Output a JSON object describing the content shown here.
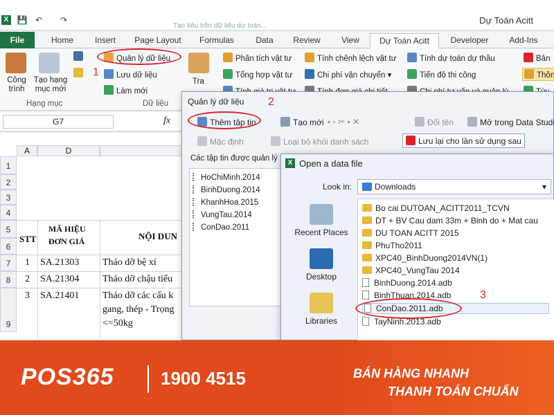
{
  "window": {
    "title": "Dự Toán Acitt",
    "background_title": "Tạo tiêu trên dữ liệu dự toán..."
  },
  "ribbon_tabs": [
    "File",
    "Home",
    "Insert",
    "Page Layout",
    "Formulas",
    "Data",
    "Review",
    "View",
    "Dự Toán Acitt",
    "Developer",
    "Add-Ins"
  ],
  "ribbon": {
    "cong_trinh": "Công trình",
    "tao_hang_muc": "Tạo hạng mục mới",
    "hang_muc_group": "Hạng mục",
    "quan_ly_du_lieu": "Quản lý dữ liệu",
    "luu_du_lieu": "Lưu dữ liệu",
    "lam_moi": "Làm mới",
    "du_lieu_group": "Dữ liệu",
    "tra": "Tra",
    "phan_tich_vat_tu": "Phân tích vật tư",
    "tong_hop_vat_tu": "Tổng hợp vật tư",
    "tinh_gia_tri": "Tính giá trị vật tư",
    "tinh_chenh_lech": "Tính chênh lệch vật tư",
    "chi_phi_van_chuyen": "Chi phí vận chuyển",
    "tinh_don_gia": "Tính đơn giá chi tiết",
    "tinh_du_toan": "Tính dự toán dự thầu",
    "tien_do": "Tiến độ thi công",
    "chi_phi_tu_van": "Chi phí tư vấn và quản lý",
    "ban": "Bản",
    "thon": "Thôn",
    "tuy": "Tùy"
  },
  "annotations": {
    "n1": "1",
    "n2": "2",
    "n3": "3"
  },
  "formula_bar": {
    "name_box": "G7",
    "fx": "fx"
  },
  "sheet": {
    "columns": [
      "A",
      "D"
    ],
    "rows": [
      "1",
      "2",
      "3",
      "4",
      "5",
      "6",
      "7",
      "8",
      "9"
    ],
    "header_stt": "STT",
    "header_ma1": "MÃ HIỆU",
    "header_ma2": "ĐƠN GIÁ",
    "header_noidung": "NỘI DUN",
    "data": [
      {
        "stt": "1",
        "ma": "SA.21303",
        "nd": "Tháo dỡ bệ xí"
      },
      {
        "stt": "2",
        "ma": "SA.21304",
        "nd": "Tháo dỡ chậu tiểu"
      },
      {
        "stt": "3",
        "ma": "SA.21401",
        "nd": "Tháo dỡ các cấu k"
      }
    ],
    "nd3_line2": "gang, thép - Trọng",
    "nd3_line3": "<=50kg"
  },
  "dialog_manage": {
    "title": "Quản lý dữ liệu",
    "btn_add": "Thêm tập tin",
    "btn_new": "Tạo mới",
    "btn_rename": "Đổi tên",
    "btn_open_studio": "Mở trong Data Studio",
    "btn_default": "Mặc định",
    "btn_remove": "Loại bỏ khỏi danh sách",
    "btn_save_later": "Lưu lại cho lần sử dụng sau",
    "list_label": "Các tập tin được quản lý",
    "files": [
      "HoChiMinh.2014",
      "BinhDuong.2014",
      "KhanhHoa.2015",
      "VungTau.2014",
      "ConDao.2011"
    ]
  },
  "dialog_open": {
    "title": "Open a data file",
    "look_in_label": "Look in:",
    "look_in_value": "Downloads",
    "places": [
      "Recent Places",
      "Desktop",
      "Libraries"
    ],
    "items": [
      {
        "name": "Bo cai DUTOAN_ACITT2011_TCVN",
        "kind": "folder"
      },
      {
        "name": "DT + BV Cau dam 33m + Binh do + Mat cau",
        "kind": "folder"
      },
      {
        "name": "DU TOAN ACITT 2015",
        "kind": "folder"
      },
      {
        "name": "PhuTho2011",
        "kind": "folder"
      },
      {
        "name": "XPC40_BinhDuong2014VN(1)",
        "kind": "folder"
      },
      {
        "name": "XPC40_VungTau 2014",
        "kind": "folder"
      },
      {
        "name": "BinhDuong.2014.adb",
        "kind": "file"
      },
      {
        "name": "BinhThuan.2014.adb",
        "kind": "file"
      },
      {
        "name": "ConDao.2011.adb",
        "kind": "file"
      },
      {
        "name": "TayNinh.2013.adb",
        "kind": "file"
      }
    ],
    "selected": "ConDao.2011.adb"
  },
  "banner": {
    "brand": "POS365",
    "hotline": "1900 4515",
    "slogan1": "BÁN HÀNG NHANH",
    "slogan2": "THANH TOÁN CHUẨN"
  },
  "colors": {
    "accent_red": "#d9262c",
    "excel_green": "#1f7244",
    "banner_orange": "#e04a1c"
  }
}
